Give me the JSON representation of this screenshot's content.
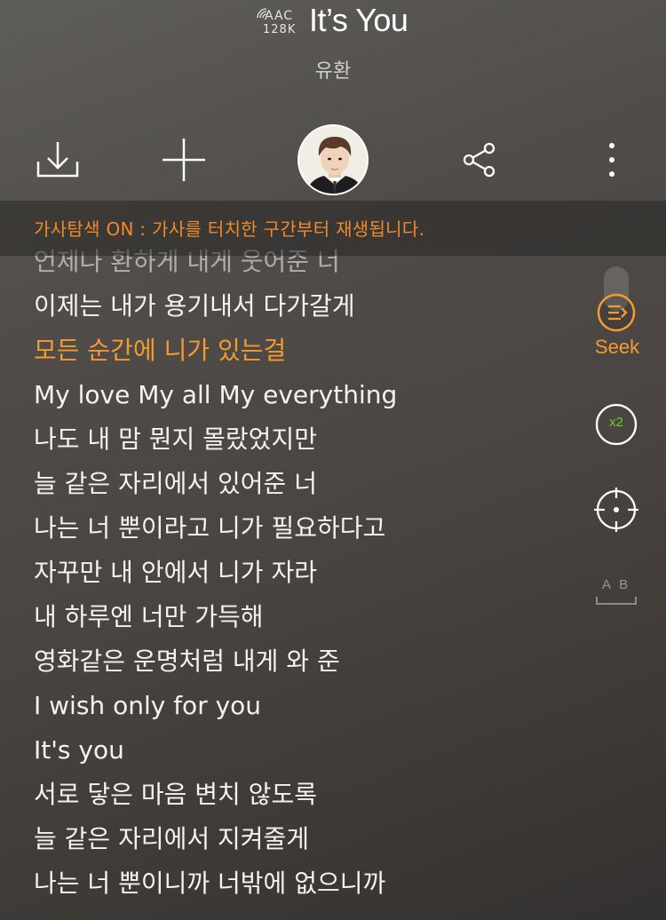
{
  "header": {
    "quality_format": "AAC",
    "quality_bitrate": "128K",
    "title": "It’s You",
    "artist": "유환"
  },
  "toolbar": {
    "download_icon": "download-icon",
    "add_icon": "plus-icon",
    "share_icon": "share-icon",
    "more_icon": "more-vertical-icon"
  },
  "banner": {
    "text": "가사탐색 ON : 가사를 터치한 구간부터 재생됩니다."
  },
  "lyrics": [
    "언제나 환하게 내게 웃어준 너",
    "이제는 내가 용기내서 다가갈게",
    "모든 순간에 니가 있는걸",
    "My love My all My everything",
    "나도 내 맘 뭔지 몰랐었지만",
    "늘 같은 자리에서 있어준 너",
    "나는 너 뿐이라고 니가 필요하다고",
    "자꾸만 내 안에서 니가 자라",
    "내 하루엔 너만 가득해",
    "영화같은 운명처럼 내게 와 준",
    "I wish only for you",
    "It's you",
    "서로 닿은 마음 변치 않도록",
    "늘 같은 자리에서 지켜줄게",
    "나는 너 뿐이니까 너밖에 없으니까"
  ],
  "side": {
    "seek_label": "Seek",
    "speed_label": "x2",
    "ab_label": "A B"
  },
  "colors": {
    "accent": "#f59a2e",
    "speed": "#6ad22a"
  }
}
